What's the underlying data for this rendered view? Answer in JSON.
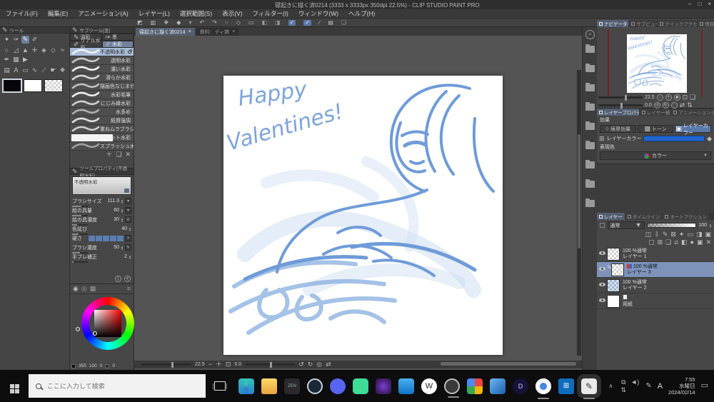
{
  "window": {
    "title": "寝起きに描く済0214 (3333 x 3333px 350dpi 22.5%) - CLIP STUDIO PAINT PRO",
    "minimize": "–",
    "maximize": "□",
    "close": "×"
  },
  "menu": {
    "items": [
      "ファイル(F)",
      "編集(E)",
      "アニメーション(A)",
      "レイヤー(L)",
      "選択範囲(S)",
      "表示(V)",
      "フィルター(I)",
      "ウィンドウ(W)",
      "ヘルプ(H)"
    ]
  },
  "command_bar": {
    "glyphs": [
      "◩",
      "▥",
      "❖",
      "◆",
      "▾",
      "↶",
      "↷",
      "○",
      "◇",
      "▭",
      "◧",
      "◨",
      "✓",
      "✓",
      "∕",
      "▤",
      "❏"
    ]
  },
  "document_tabs": {
    "tab1": "寝起きに描く済0214",
    "tab1_close": "×",
    "tab2": "資料：ディ姉",
    "tab2_close": "×"
  },
  "tool_panel": {
    "header": "ツール",
    "glyphs_r1": [
      "✦",
      "✑",
      "✎",
      "✐"
    ],
    "glyphs_r2": [
      "○",
      "◿",
      "▲",
      "✛",
      "◈",
      "◇",
      "≈"
    ],
    "glyphs_r3": [
      "✒",
      "▦",
      "▶"
    ],
    "glyphs_r4": [
      "▤",
      "A",
      "▭",
      "∿",
      "⟋",
      "☛"
    ],
    "glyphs_r5": [
      "❖"
    ]
  },
  "subtool": {
    "header": "サブツール[塗]",
    "tab_oil": "油彩",
    "tab_sumi": "墨",
    "tab_real": "リアル水彩",
    "tab_water": "水彩",
    "brushes": [
      "不透明水彩",
      "透明水彩",
      "濃い水彩",
      "滑らか水彩",
      "描画色なじませ",
      "水彩毛筆",
      "にじみ縁水彩",
      "水多め",
      "紙質強調",
      "重ねムラブラシ",
      "ウェット水彩",
      "スプラッシュ水彩"
    ],
    "foot": [
      "＋",
      "❏",
      "✕"
    ]
  },
  "tool_property": {
    "header": "ツールプロパティ[不透明水彩]",
    "preview_label": "不透明水彩",
    "brush_size_label": "ブラシサイズ",
    "brush_size": "111.3",
    "paint_amount_label": "絵の具量",
    "paint_amount": "60",
    "paint_density_label": "絵の具濃度",
    "paint_density": "30",
    "color_stretch_label": "色延び",
    "color_stretch": "40",
    "hardness_label": "硬さ",
    "brush_density_label": "ブラシ濃度",
    "brush_density": "50",
    "stabilization_label": "手ブレ補正",
    "stabilization": "2"
  },
  "color_panel": {
    "h": "355",
    "s": "100",
    "v": "0",
    "alpha": "0"
  },
  "canvas": {
    "sketch_text1": "Happy",
    "sketch_text2": "Valentines!",
    "zoom": "22.5",
    "rotation": "0.0",
    "sketch_blue": "#6f9bd8"
  },
  "navigator": {
    "tab_navigator": "ナビゲーター",
    "tab_subview": "サブビュー",
    "tab_quick": "クイックアクセス",
    "tab_info": "情報",
    "zoom": "22.5",
    "rotation": "0.0"
  },
  "layer_property": {
    "tab_main": "レイヤープロパティ",
    "tab_search": "レイヤー検索",
    "tab_anim": "アニメーションセル",
    "effect_label": "効果",
    "border_effect": "境界効果",
    "tone": "トーン",
    "layer_color": "レイヤーカラー",
    "layer_color_row": "レイヤーカラー",
    "expression_label": "表現色",
    "expression_value": "カラー",
    "layer_color_hex": "#1f66d2"
  },
  "layers": {
    "tab_layer": "レイヤー",
    "tab_timeline": "タイムライン",
    "tab_autoaction": "オートアクション",
    "blend_mode": "通常",
    "opacity": "100",
    "items": [
      {
        "mode": "100 %通常",
        "name": "レイヤー 1"
      },
      {
        "mode": "100 %通常",
        "name": "レイヤー 3"
      },
      {
        "mode": "100 %通常",
        "name": "レイヤー 2"
      },
      {
        "mode": "",
        "name": "用紙"
      }
    ]
  },
  "taskbar": {
    "search_placeholder": "ここに入力して検索",
    "ime": "A",
    "time": "7:55",
    "day": "水曜日",
    "date": "2024/02/14"
  }
}
